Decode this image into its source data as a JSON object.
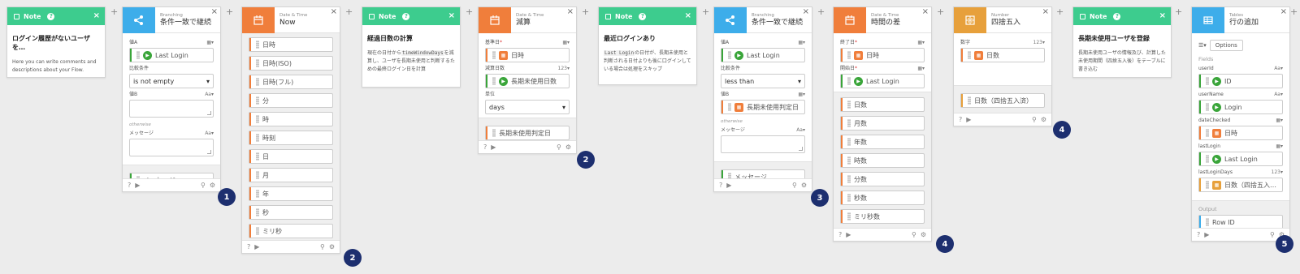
{
  "colors": {
    "note": "#3dcc8e",
    "branching": "#3dadea",
    "datetime": "#f07e3b",
    "number": "#e7a03b",
    "tables": "#3dadea",
    "badge": "#1d2f6f"
  },
  "note1": {
    "header": "Note",
    "title": "ログイン履歴がないユーザを…",
    "body": "Here you can write comments and descriptions about your Flow."
  },
  "branch1": {
    "category": "Branching",
    "title": "条件一致で継続",
    "valueA_label": "値A",
    "valueA": "Last Login",
    "cond_label": "比較条件",
    "cond": "is not empty",
    "valueB_label": "値B",
    "otherwise": "otherwise",
    "message_label": "メッセージ",
    "type_label": "Aa▾",
    "output": "メッセージ"
  },
  "now": {
    "category": "Date & Time",
    "title": "Now",
    "outputs": [
      "日時",
      "日時(ISO)",
      "日時(フル)",
      "分",
      "時",
      "時刻",
      "日",
      "月",
      "年",
      "秒",
      "ミリ秒"
    ]
  },
  "note2": {
    "header": "Note",
    "title": "経過日数の計算",
    "body_pre": "現在の日付から",
    "body_code": "timeWindowDays",
    "body_post": "を減算し、ユーザを長期未使用と判断するための最終ログイン日を計算"
  },
  "subtract": {
    "category": "Date & Time",
    "title": "減算",
    "base_label": "基準日",
    "base": "日時",
    "amount_label": "減算日数",
    "amount_type": "123▾",
    "amount": "長期未使用日数",
    "unit_label": "単位",
    "unit": "days",
    "output": "長期未使用判定日"
  },
  "note3": {
    "header": "Note",
    "title": "最近ログインあり",
    "body_code": "Last Login",
    "body_post": "の日付が、長期未使用と判断される日付よりも後に口グインしている場合は処理をスキップ"
  },
  "branch2": {
    "category": "Branching",
    "title": "条件一致で継続",
    "valueA_label": "値A",
    "valueA": "Last Login",
    "cond_label": "比較条件",
    "cond": "less than",
    "valueB_label": "値B",
    "valueB": "長期未使用判定日",
    "otherwise": "otherwise",
    "message_label": "メッセージ",
    "type_label": "Aa▾",
    "output": "メッセージ"
  },
  "diff": {
    "category": "Date & Time",
    "title": "時間の差",
    "end_label": "終了日",
    "end": "日時",
    "start_label": "開始日",
    "start": "Last Login",
    "outputs": [
      "日数",
      "月数",
      "年数",
      "時数",
      "分数",
      "秒数",
      "ミリ秒数"
    ]
  },
  "round": {
    "category": "Number",
    "title": "四捨五入",
    "num_label": "数字",
    "num_type": "123▾",
    "num": "日数",
    "output": "日数（四捨五入済）"
  },
  "note4": {
    "header": "Note",
    "title": "長期未使用ユーザを登録",
    "body": "長期未使用ユーザの情報及び、計算した未使用期間（四捨五入後）をテーブルに書き込む"
  },
  "addrow": {
    "category": "Tables",
    "title": "行の追加",
    "options": "Options",
    "fields_label": "Fields",
    "fields": [
      {
        "label": "userId",
        "type": "Aa▾",
        "value": "ID",
        "color": "g"
      },
      {
        "label": "userName",
        "type": "Aa▾",
        "value": "Login",
        "color": "g"
      },
      {
        "label": "dateChecked",
        "type": "▦▾",
        "value": "日時",
        "color": "o"
      },
      {
        "label": "lastLogin",
        "type": "▦▾",
        "value": "Last Login",
        "color": "g"
      },
      {
        "label": "lastLoginDays",
        "type": "123▾",
        "value": "日数（四捨五入…",
        "color": "y"
      }
    ],
    "output_label": "Output",
    "output": "Row ID"
  },
  "badges": [
    "1",
    "2",
    "2",
    "3",
    "4",
    "4",
    "5"
  ]
}
